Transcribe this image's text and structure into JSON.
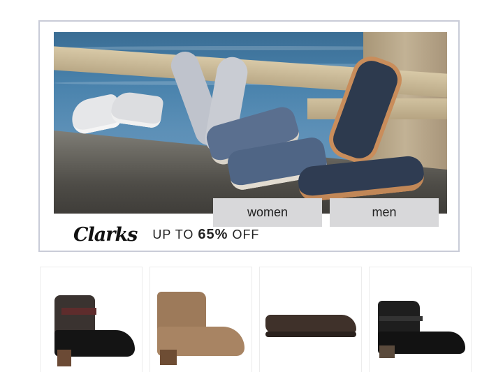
{
  "banner": {
    "brand": "Clarks",
    "promo_prefix": "UP TO ",
    "promo_percent": "65%",
    "promo_suffix": " OFF",
    "buttons": {
      "women": "women",
      "men": "men"
    }
  },
  "products": [
    {
      "type": "block-heel-ankle-bootie"
    },
    {
      "type": "suede-ankle-bootie"
    },
    {
      "type": "slip-on-flat"
    },
    {
      "type": "black-ankle-bootie"
    }
  ]
}
